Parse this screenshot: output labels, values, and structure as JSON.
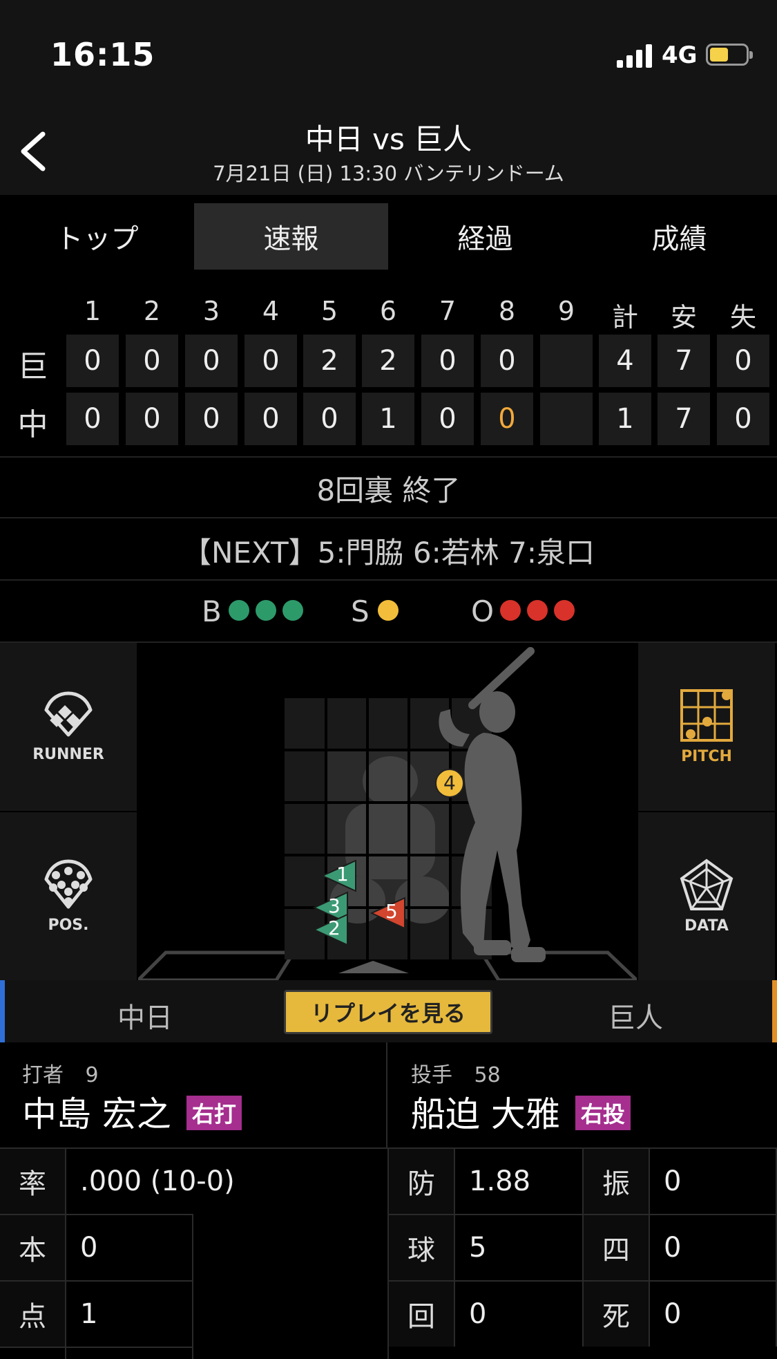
{
  "status_bar": {
    "time": "16:15",
    "network": "4G"
  },
  "header": {
    "title": "中日 vs 巨人",
    "subtitle": "7月21日 (日) 13:30 バンテリンドーム"
  },
  "tabs": [
    {
      "label": "トップ",
      "active": false
    },
    {
      "label": "速報",
      "active": true
    },
    {
      "label": "経過",
      "active": false
    },
    {
      "label": "成績",
      "active": false
    }
  ],
  "scoreboard": {
    "columns": [
      "1",
      "2",
      "3",
      "4",
      "5",
      "6",
      "7",
      "8",
      "9",
      "計",
      "安",
      "失"
    ],
    "rows": [
      {
        "team": "巨",
        "innings": [
          "0",
          "0",
          "0",
          "0",
          "2",
          "2",
          "0",
          "0",
          ""
        ],
        "totals": [
          "4",
          "7",
          "0"
        ]
      },
      {
        "team": "中",
        "innings": [
          "0",
          "0",
          "0",
          "0",
          "0",
          "1",
          "0",
          "0",
          ""
        ],
        "totals": [
          "1",
          "7",
          "0"
        ]
      }
    ],
    "highlight_color": "#f2a93b"
  },
  "game_state": "8回裏 終了",
  "next_batters": "【NEXT】5:門脇 6:若林 7:泉口",
  "count": {
    "balls_label": "B",
    "balls": 3,
    "strikes_label": "S",
    "strikes": 1,
    "outs_label": "O",
    "outs": 3,
    "colors": {
      "ball": "#2d9a6a",
      "strike": "#f2bd3a",
      "out": "#d8322a"
    }
  },
  "side_buttons": {
    "runner": "RUNNER",
    "pos": "POS.",
    "pitch": "PITCH",
    "data": "DATA"
  },
  "pitches": [
    {
      "number": "4",
      "kind": "circle",
      "color": "#f2bd3a"
    },
    {
      "number": "1",
      "kind": "triangle",
      "color": "#3b9a74"
    },
    {
      "number": "3",
      "kind": "triangle",
      "color": "#3b9a74"
    },
    {
      "number": "2",
      "kind": "triangle",
      "color": "#3b9a74"
    },
    {
      "number": "5",
      "kind": "triangle",
      "color": "#d2452e"
    }
  ],
  "team_bar": {
    "left_team": "中日",
    "replay_label": "リプレイを見る",
    "right_team": "巨人"
  },
  "batter": {
    "role": "打者",
    "number": "9",
    "name": "中島 宏之",
    "badge": "右打"
  },
  "pitcher": {
    "role": "投手",
    "number": "58",
    "name": "船迫 大雅",
    "badge": "右投"
  },
  "batter_stats": [
    {
      "key": "率",
      "value": ".000 (10-0)"
    },
    {
      "key": "本",
      "value": "0"
    },
    {
      "key": "点",
      "value": "1"
    }
  ],
  "pitcher_stats": [
    {
      "key": "防",
      "value": "1.88",
      "key2": "振",
      "value2": "0"
    },
    {
      "key": "球",
      "value": "5",
      "key2": "四",
      "value2": "0"
    },
    {
      "key": "回",
      "value": "0",
      "key2": "死",
      "value2": "0"
    }
  ]
}
